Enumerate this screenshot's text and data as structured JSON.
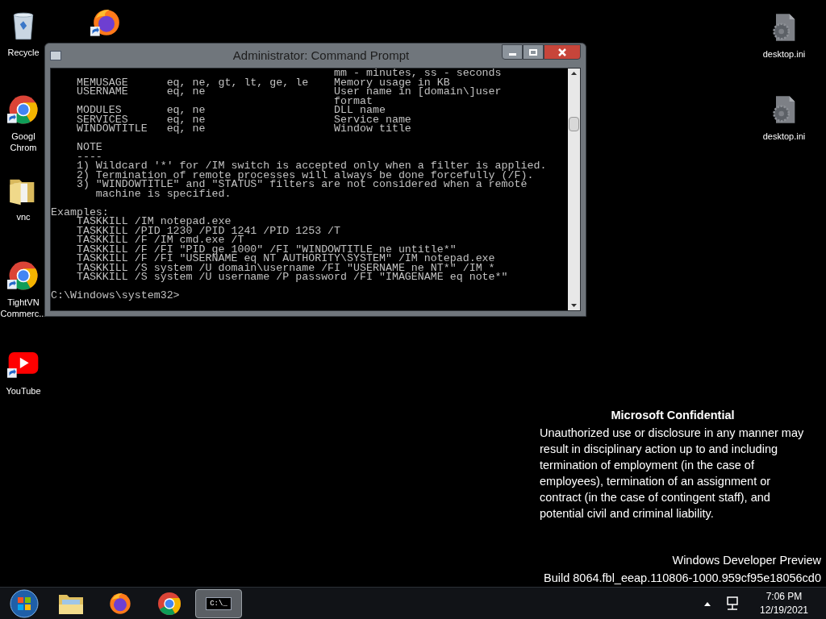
{
  "desktop_icons": [
    {
      "kind": "recycle",
      "label_lines": [
        "Recycle"
      ]
    },
    {
      "kind": "firefox"
    },
    {
      "kind": "chrome",
      "label_lines": [
        "Googl",
        "Chrom"
      ]
    },
    {
      "kind": "folder",
      "label_lines": [
        "vnc"
      ]
    },
    {
      "kind": "chrome",
      "label_lines": [
        "TightVN",
        "Commerc..."
      ]
    },
    {
      "kind": "youtube",
      "label_lines": [
        "YouTube"
      ]
    },
    {
      "kind": "settings_file",
      "label_lines": [
        "desktop.ini"
      ]
    },
    {
      "kind": "settings_file",
      "label_lines": [
        "desktop.ini"
      ]
    }
  ],
  "window": {
    "title": "Administrator: Command Prompt",
    "console_blocks": [
      [
        "                                            mm - minutes, ss - seconds",
        "    MEMUSAGE      eq, ne, gt, lt, ge, le    Memory usage in KB",
        "    USERNAME      eq, ne                    User name in [domain\\]user",
        "                                            format",
        "    MODULES       eq, ne                    DLL name",
        "    SERVICES      eq, ne                    Service name",
        "    WINDOWTITLE   eq, ne                    Window title"
      ],
      [
        "    NOTE",
        "    ----",
        "    1) Wildcard '*' for /IM switch is accepted only when a filter is applied.",
        "    2) Termination of remote processes will always be done forcefully (/F).",
        "    3) \"WINDOWTITLE\" and \"STATUS\" filters are not considered when a remote",
        "       machine is specified."
      ],
      [
        "Examples:",
        "    TASKKILL /IM notepad.exe",
        "    TASKKILL /PID 1230 /PID 1241 /PID 1253 /T",
        "    TASKKILL /F /IM cmd.exe /T",
        "    TASKKILL /F /FI \"PID ge 1000\" /FI \"WINDOWTITLE ne untitle*\"",
        "    TASKKILL /F /FI \"USERNAME eq NT AUTHORITY\\SYSTEM\" /IM notepad.exe",
        "    TASKKILL /S system /U domain\\username /FI \"USERNAME ne NT*\" /IM *",
        "    TASKKILL /S system /U username /P password /FI \"IMAGENAME eq note*\""
      ],
      [
        "C:\\Windows\\system32>"
      ]
    ]
  },
  "watermark": {
    "title": "Microsoft Confidential",
    "text": "Unauthorized use or disclosure in any manner may result in disciplinary action up to and including termination of employment (in the case of employees), termination of an assignment or contract (in the case of contingent staff), and potential civil and criminal liability.",
    "edition": "Windows Developer Preview",
    "build": "Build 8064.fbl_eeap.110806-1000.959cf95e18056cd0"
  },
  "taskbar": {
    "items": [
      {
        "kind": "explorer",
        "selected": false
      },
      {
        "kind": "firefox",
        "selected": false
      },
      {
        "kind": "chrome",
        "selected": false
      },
      {
        "kind": "cmd",
        "selected": true,
        "glyph": "C:\\_"
      }
    ],
    "time": "7:06 PM",
    "date": "12/19/2021"
  }
}
